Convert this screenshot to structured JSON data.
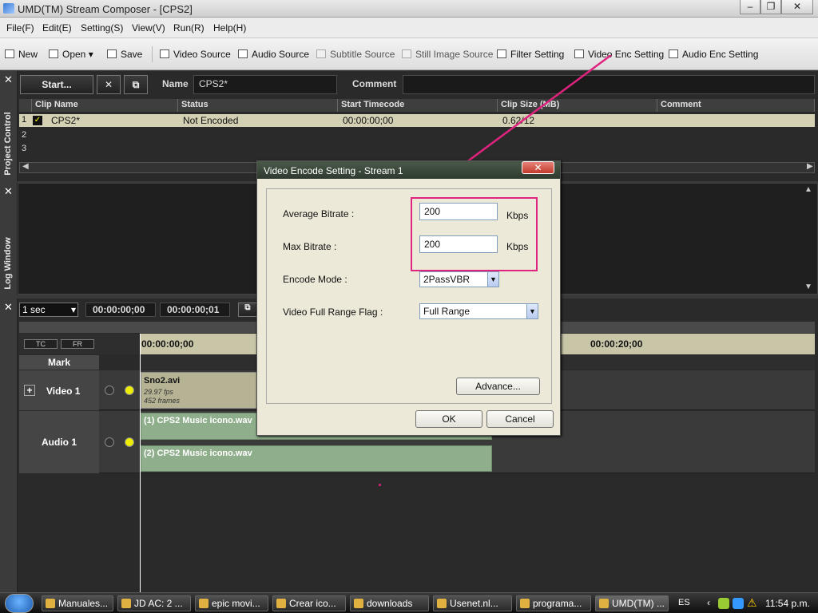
{
  "window": {
    "title": "UMD(TM) Stream Composer - [CPS2]",
    "min": "–",
    "max": "❐",
    "close": "✕"
  },
  "menu": [
    "File(F)",
    "Edit(E)",
    "Setting(S)",
    "View(V)",
    "Run(R)",
    "Help(H)"
  ],
  "toolbar": {
    "new": "New",
    "open": "Open",
    "save": "Save",
    "video_source": "Video Source",
    "audio_source": "Audio Source",
    "subtitle_source": "Subtitle Source",
    "still_image_source": "Still Image Source",
    "filter_setting": "Filter Setting",
    "video_enc_setting": "Video Enc Setting",
    "audio_enc_setting": "Audio Enc Setting"
  },
  "project": {
    "panel_label": "Project Control",
    "start_label": "Start...",
    "name_label": "Name",
    "name_value": "CPS2*",
    "comment_label": "Comment",
    "comment_value": "",
    "columns": [
      "Clip Name",
      "Status",
      "Start Timecode",
      "Clip Size (MB)",
      "Comment"
    ],
    "rows": [
      {
        "num": "1",
        "clip": "CPS2*",
        "status": "Not Encoded",
        "tc": "00:00:00;00",
        "size": "0.62/12",
        "comment": ""
      },
      {
        "num": "2"
      },
      {
        "num": "3"
      }
    ]
  },
  "log": {
    "panel_label": "Log Window"
  },
  "timeline": {
    "scale": "1 sec",
    "tc_start": "00:00:00;00",
    "tc_end": "00:00:00;01",
    "tc_btn": "TC",
    "fr_btn": "FR",
    "mark": "Mark",
    "ruler_start": "00:00:00;00",
    "ruler_20": "00:00:20;00",
    "video_track": "Video 1",
    "audio_track": "Audio 1",
    "video_clip": {
      "name": "Sno2.avi",
      "fps": "29.97 fps",
      "frames": "452 frames"
    },
    "audio_clip_1": "(1) CPS2 Music icono.wav",
    "audio_clip_2": "(2) CPS2 Music icono.wav"
  },
  "dialog": {
    "title": "Video Encode Setting - Stream 1",
    "avg_label": "Average Bitrate :",
    "avg_value": "200",
    "avg_unit": "Kbps",
    "max_label": "Max Bitrate :",
    "max_value": "200",
    "max_unit": "Kbps",
    "mode_label": "Encode Mode :",
    "mode_value": "2PassVBR",
    "range_label": "Video Full Range Flag :",
    "range_value": "Full Range",
    "advance": "Advance...",
    "ok": "OK",
    "cancel": "Cancel"
  },
  "taskbar": {
    "items": [
      "Manuales...",
      "JD AC: 2 ...",
      "epic movi...",
      "Crear ico...",
      "downloads",
      "Usenet.nl...",
      "programa...",
      "UMD(TM) ..."
    ],
    "lang": "ES",
    "time": "11:54 p.m."
  },
  "colors": {
    "accent": "#e0237e",
    "dialog_bg": "#ece9d8",
    "panel": "#2a2a2a"
  }
}
